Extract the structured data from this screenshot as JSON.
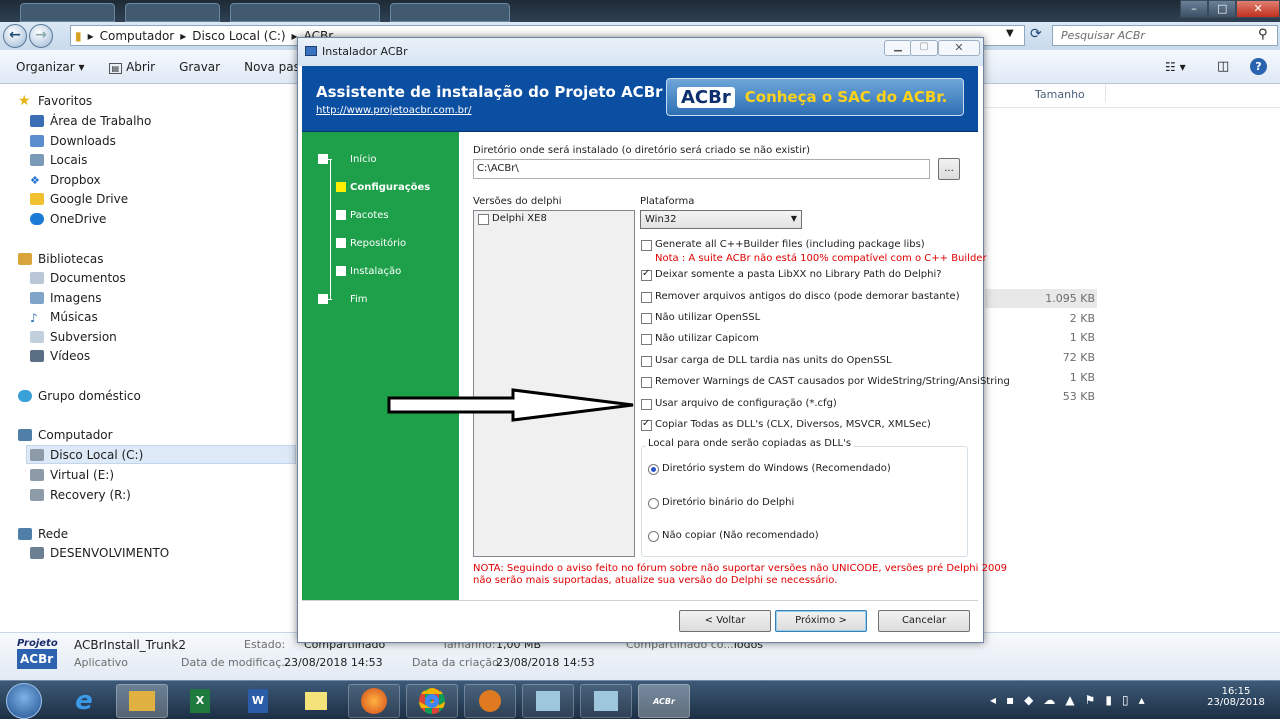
{
  "explorer": {
    "address": [
      "Computador",
      "Disco Local (C:)",
      "ACBr"
    ],
    "search_placeholder": "Pesquisar ACBr",
    "toolbar": [
      "Organizar ▾",
      "Abrir",
      "Gravar",
      "Nova pasta"
    ],
    "col_size": "Tamanho",
    "nav": {
      "favorites": "Favoritos",
      "fav_items": [
        "Área de Trabalho",
        "Downloads",
        "Locais",
        "Dropbox",
        "Google Drive",
        "OneDrive"
      ],
      "libraries": "Bibliotecas",
      "lib_items": [
        "Documentos",
        "Imagens",
        "Músicas",
        "Subversion",
        "Vídeos"
      ],
      "homegroup": "Grupo doméstico",
      "computer": "Computador",
      "comp_items": [
        "Disco Local (C:)",
        "Virtual (E:)",
        "Recovery (R:)"
      ],
      "network": "Rede",
      "net_items": [
        "DESENVOLVIMENTO"
      ]
    },
    "sizes": [
      "1.095 KB",
      "2 KB",
      "1 KB",
      "72 KB",
      "1 KB",
      "53 KB"
    ],
    "details": {
      "name": "ACBrInstall_Trunk2",
      "type": "Aplicativo",
      "state_label": "Estado:",
      "state_value": "Compartilhado",
      "modified_label": "Data de modificaç...",
      "modified_value": "23/08/2018 14:53",
      "created_label": "Data da criação:",
      "created_value": "23/08/2018 14:53",
      "size_label": "Tamanho:",
      "size_value": "1,00 MB",
      "shared_label": "Compartilhado co...",
      "shared_value": "Todos"
    }
  },
  "dialog": {
    "title": "Instalador ACBr",
    "header_title": "Assistente de instalação do Projeto ACBr",
    "header_link": "http://www.projetoacbr.com.br/",
    "banner_logo": "ACBr",
    "banner_text": "Conheça o SAC do ACBr.",
    "steps": [
      "Início",
      "Configurações",
      "Pacotes",
      "Repositório",
      "Instalação",
      "Fim"
    ],
    "dir_label": "Diretório onde será instalado (o diretório será criado se não existir)",
    "dir_value": "C:\\ACBr\\",
    "browse": "...",
    "versions_label": "Versões do delphi",
    "versions": [
      "Delphi XE8"
    ],
    "platform_label": "Plataforma",
    "platform_value": "Win32",
    "options": [
      {
        "label": "Generate all C++Builder files (including package libs)",
        "checked": false
      },
      {
        "label": "Deixar somente a pasta LibXX no Library Path do Delphi?",
        "checked": true
      },
      {
        "label": "Remover arquivos antigos do disco (pode demorar bastante)",
        "checked": false
      },
      {
        "label": "Não utilizar OpenSSL",
        "checked": false
      },
      {
        "label": "Não utilizar Capicom",
        "checked": false
      },
      {
        "label": "Usar carga de DLL tardia nas units do OpenSSL",
        "checked": false
      },
      {
        "label": "Remover Warnings de CAST causados por WideString/String/AnsiString",
        "checked": false
      },
      {
        "label": "Usar arquivo de configuração (*.cfg)",
        "checked": false
      },
      {
        "label": "Copiar Todas as DLL's (CLX, Diversos, MSVCR, XMLSec)",
        "checked": true
      }
    ],
    "cpp_note": "Nota : A suite ACBr não está 100% compatível com o C++ Builder",
    "dll_group": "Local para onde serão copiadas as DLL's",
    "dll_options": [
      "Diretório system do Windows (Recomendado)",
      "Diretório binário do Delphi",
      "Não copiar (Não recomendado)"
    ],
    "dll_selected": 0,
    "note_line1": "NOTA: Seguindo o aviso feito no fórum sobre não suportar versões não UNICODE, versões pré Delphi 2009",
    "note_line2": "não serão mais suportadas, atualize sua versão do Delphi se necessário.",
    "btn_back": "< Voltar",
    "btn_next": "Próximo >",
    "btn_cancel": "Cancelar"
  },
  "taskbar": {
    "time": "16:15",
    "date": "23/08/2018"
  },
  "colors": {
    "header_blue": "#0b4fa3",
    "steps_green": "#1ea04a",
    "note_red": "#e00000"
  }
}
